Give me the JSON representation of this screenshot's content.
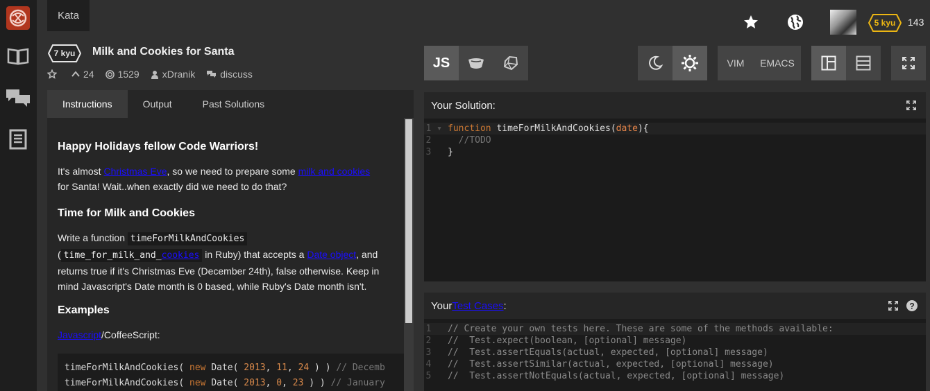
{
  "nav": {
    "kata_tab": "Kata"
  },
  "header": {
    "rank_label": "5 kyu",
    "honor": "143"
  },
  "kata": {
    "rank": "7 kyu",
    "title": "Milk and Cookies for Santa",
    "votes": "24",
    "completions": "1529",
    "author": "xDranik",
    "discuss_label": "discuss"
  },
  "tabs": [
    "Instructions",
    "Output",
    "Past Solutions"
  ],
  "instructions": {
    "h1": "Happy Holidays fellow Code Warriors!",
    "p1_a": "It's almost ",
    "p1_link1": "Christmas Eve",
    "p1_b": ", so we need to prepare some ",
    "p1_link2": "milk and cookies",
    "p1_c": " for Santa! Wait..when exactly did we need to do that?",
    "h2": "Time for Milk and Cookies",
    "p2_a": "Write a function ",
    "p2_code1": "timeForMilkAndCookies",
    "p2_code2a": "time_for_milk_and_",
    "p2_code2b": "cookies",
    "p2_b": " in Ruby) that accepts a ",
    "p2_link": "Date object",
    "p2_c": ", and returns true if it's Christmas Eve (December 24th), false otherwise. Keep in mind Javascript's Date month is 0 based, while Ruby's Date month isn't.",
    "h3": "Examples",
    "p3_link": "Javascript",
    "p3_rest": "/CoffeeScript:",
    "ex_line1_comment": "// Decemb",
    "ex_line2_comment": "// January"
  },
  "toolbar": {
    "lang_js": "JS",
    "vim": "VIM",
    "emacs": "EMACS"
  },
  "solution": {
    "title": "Your Solution:",
    "code": {
      "l1_kw": "function",
      "l1_name": "timeForMilkAndCookies",
      "l1_param": "date",
      "l2": "  //TODO",
      "l3": "}"
    }
  },
  "tests": {
    "title_a": "Your ",
    "title_link": "Test Cases",
    "title_b": ":",
    "lines": [
      "// Create your own tests here. These are some of the methods available:",
      "//  Test.expect(boolean, [optional] message)",
      "//  Test.assertEquals(actual, expected, [optional] message)",
      "//  Test.assertSimilar(actual, expected, [optional] message)",
      "//  Test.assertNotEquals(actual, expected, [optional] message)"
    ]
  },
  "colors": {
    "brand": "#b1361e",
    "rank_yellow": "#ecb613",
    "link": "#1a0dff"
  }
}
